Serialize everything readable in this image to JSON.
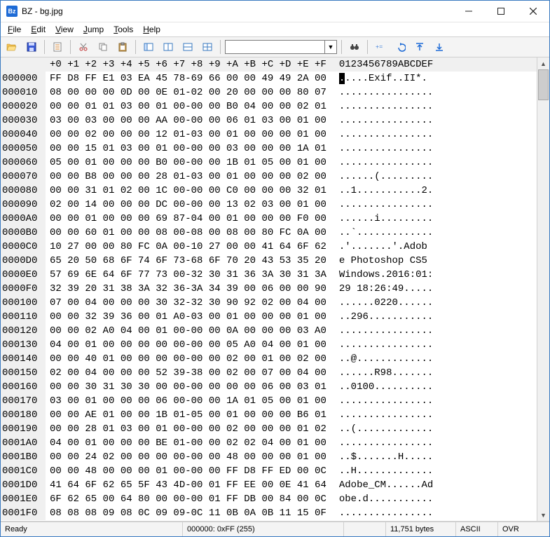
{
  "titlebar": {
    "icon_text": "Bz",
    "title": "BZ - bg.jpg"
  },
  "menu": {
    "file": "File",
    "edit": "Edit",
    "view": "View",
    "jump": "Jump",
    "tools": "Tools",
    "help": "Help"
  },
  "status": {
    "ready": "Ready",
    "offset": "000000: 0xFF (255)",
    "pad": "",
    "size": "11,751 bytes",
    "enc": "ASCII",
    "mode": "OVR"
  },
  "hex_header": {
    "addr_blank": "      ",
    "cols": [
      "+0",
      "+1",
      "+2",
      "+3",
      "+4",
      "+5",
      "+6",
      "+7",
      "+8",
      "+9",
      "+A",
      "+B",
      "+C",
      "+D",
      "+E",
      "+F"
    ],
    "ascii": "0123456789ABCDEF"
  },
  "rows": [
    {
      "addr": "000000",
      "b": [
        "FF",
        "D8",
        "FF",
        "E1",
        "03",
        "EA",
        "45",
        "78",
        "69",
        "66",
        "00",
        "00",
        "49",
        "49",
        "2A",
        "00"
      ],
      "a": ".....Exif..II*."
    },
    {
      "addr": "000010",
      "b": [
        "08",
        "00",
        "00",
        "00",
        "0D",
        "00",
        "0E",
        "01",
        "02",
        "00",
        "20",
        "00",
        "00",
        "00",
        "80",
        "07"
      ],
      "a": "................"
    },
    {
      "addr": "000020",
      "b": [
        "00",
        "00",
        "01",
        "01",
        "03",
        "00",
        "01",
        "00",
        "00",
        "00",
        "B0",
        "04",
        "00",
        "00",
        "02",
        "01"
      ],
      "a": "................"
    },
    {
      "addr": "000030",
      "b": [
        "03",
        "00",
        "03",
        "00",
        "00",
        "00",
        "AA",
        "00",
        "00",
        "00",
        "06",
        "01",
        "03",
        "00",
        "01",
        "00"
      ],
      "a": "................"
    },
    {
      "addr": "000040",
      "b": [
        "00",
        "00",
        "02",
        "00",
        "00",
        "00",
        "12",
        "01",
        "03",
        "00",
        "01",
        "00",
        "00",
        "00",
        "01",
        "00"
      ],
      "a": "................"
    },
    {
      "addr": "000050",
      "b": [
        "00",
        "00",
        "15",
        "01",
        "03",
        "00",
        "01",
        "00",
        "00",
        "00",
        "03",
        "00",
        "00",
        "00",
        "1A",
        "01"
      ],
      "a": "................"
    },
    {
      "addr": "000060",
      "b": [
        "05",
        "00",
        "01",
        "00",
        "00",
        "00",
        "B0",
        "00",
        "00",
        "00",
        "1B",
        "01",
        "05",
        "00",
        "01",
        "00"
      ],
      "a": "................"
    },
    {
      "addr": "000070",
      "b": [
        "00",
        "00",
        "B8",
        "00",
        "00",
        "00",
        "28",
        "01",
        "03",
        "00",
        "01",
        "00",
        "00",
        "00",
        "02",
        "00"
      ],
      "a": "......(........."
    },
    {
      "addr": "000080",
      "b": [
        "00",
        "00",
        "31",
        "01",
        "02",
        "00",
        "1C",
        "00",
        "00",
        "00",
        "C0",
        "00",
        "00",
        "00",
        "32",
        "01"
      ],
      "a": "..1...........2."
    },
    {
      "addr": "000090",
      "b": [
        "02",
        "00",
        "14",
        "00",
        "00",
        "00",
        "DC",
        "00",
        "00",
        "00",
        "13",
        "02",
        "03",
        "00",
        "01",
        "00"
      ],
      "a": "................"
    },
    {
      "addr": "0000A0",
      "b": [
        "00",
        "00",
        "01",
        "00",
        "00",
        "00",
        "69",
        "87",
        "04",
        "00",
        "01",
        "00",
        "00",
        "00",
        "F0",
        "00"
      ],
      "a": "......i........."
    },
    {
      "addr": "0000B0",
      "b": [
        "00",
        "00",
        "60",
        "01",
        "00",
        "00",
        "08",
        "00",
        "08",
        "00",
        "08",
        "00",
        "80",
        "FC",
        "0A",
        "00"
      ],
      "a": "..`............."
    },
    {
      "addr": "0000C0",
      "b": [
        "10",
        "27",
        "00",
        "00",
        "80",
        "FC",
        "0A",
        "00",
        "10",
        "27",
        "00",
        "00",
        "41",
        "64",
        "6F",
        "62"
      ],
      "a": ".'.......'.Adob"
    },
    {
      "addr": "0000D0",
      "b": [
        "65",
        "20",
        "50",
        "68",
        "6F",
        "74",
        "6F",
        "73",
        "68",
        "6F",
        "70",
        "20",
        "43",
        "53",
        "35",
        "20"
      ],
      "a": "e Photoshop CS5 "
    },
    {
      "addr": "0000E0",
      "b": [
        "57",
        "69",
        "6E",
        "64",
        "6F",
        "77",
        "73",
        "00",
        "32",
        "30",
        "31",
        "36",
        "3A",
        "30",
        "31",
        "3A"
      ],
      "a": "Windows.2016:01:"
    },
    {
      "addr": "0000F0",
      "b": [
        "32",
        "39",
        "20",
        "31",
        "38",
        "3A",
        "32",
        "36",
        "3A",
        "34",
        "39",
        "00",
        "06",
        "00",
        "00",
        "90"
      ],
      "a": "29 18:26:49....."
    },
    {
      "addr": "000100",
      "b": [
        "07",
        "00",
        "04",
        "00",
        "00",
        "00",
        "30",
        "32",
        "32",
        "30",
        "90",
        "92",
        "02",
        "00",
        "04",
        "00"
      ],
      "a": "......0220......"
    },
    {
      "addr": "000110",
      "b": [
        "00",
        "00",
        "32",
        "39",
        "36",
        "00",
        "01",
        "A0",
        "03",
        "00",
        "01",
        "00",
        "00",
        "00",
        "01",
        "00"
      ],
      "a": "..296..........."
    },
    {
      "addr": "000120",
      "b": [
        "00",
        "00",
        "02",
        "A0",
        "04",
        "00",
        "01",
        "00",
        "00",
        "00",
        "0A",
        "00",
        "00",
        "00",
        "03",
        "A0"
      ],
      "a": "................"
    },
    {
      "addr": "000130",
      "b": [
        "04",
        "00",
        "01",
        "00",
        "00",
        "00",
        "00",
        "00",
        "00",
        "00",
        "05",
        "A0",
        "04",
        "00",
        "01",
        "00"
      ],
      "a": "................"
    },
    {
      "addr": "000140",
      "b": [
        "00",
        "00",
        "40",
        "01",
        "00",
        "00",
        "00",
        "00",
        "00",
        "00",
        "02",
        "00",
        "01",
        "00",
        "02",
        "00"
      ],
      "a": "..@............."
    },
    {
      "addr": "000150",
      "b": [
        "02",
        "00",
        "04",
        "00",
        "00",
        "00",
        "52",
        "39",
        "38",
        "00",
        "02",
        "00",
        "07",
        "00",
        "04",
        "00"
      ],
      "a": "......R98......."
    },
    {
      "addr": "000160",
      "b": [
        "00",
        "00",
        "30",
        "31",
        "30",
        "30",
        "00",
        "00",
        "00",
        "00",
        "00",
        "00",
        "06",
        "00",
        "03",
        "01"
      ],
      "a": "..0100.........."
    },
    {
      "addr": "000170",
      "b": [
        "03",
        "00",
        "01",
        "00",
        "00",
        "00",
        "06",
        "00",
        "00",
        "00",
        "1A",
        "01",
        "05",
        "00",
        "01",
        "00"
      ],
      "a": "................"
    },
    {
      "addr": "000180",
      "b": [
        "00",
        "00",
        "AE",
        "01",
        "00",
        "00",
        "1B",
        "01",
        "05",
        "00",
        "01",
        "00",
        "00",
        "00",
        "B6",
        "01"
      ],
      "a": "................"
    },
    {
      "addr": "000190",
      "b": [
        "00",
        "00",
        "28",
        "01",
        "03",
        "00",
        "01",
        "00",
        "00",
        "00",
        "02",
        "00",
        "00",
        "00",
        "01",
        "02"
      ],
      "a": "..(............."
    },
    {
      "addr": "0001A0",
      "b": [
        "04",
        "00",
        "01",
        "00",
        "00",
        "00",
        "BE",
        "01",
        "00",
        "00",
        "02",
        "02",
        "04",
        "00",
        "01",
        "00"
      ],
      "a": "................"
    },
    {
      "addr": "0001B0",
      "b": [
        "00",
        "00",
        "24",
        "02",
        "00",
        "00",
        "00",
        "00",
        "00",
        "00",
        "48",
        "00",
        "00",
        "00",
        "01",
        "00"
      ],
      "a": "..$.......H....."
    },
    {
      "addr": "0001C0",
      "b": [
        "00",
        "00",
        "48",
        "00",
        "00",
        "00",
        "01",
        "00",
        "00",
        "00",
        "FF",
        "D8",
        "FF",
        "ED",
        "00",
        "0C"
      ],
      "a": "..H............."
    },
    {
      "addr": "0001D0",
      "b": [
        "41",
        "64",
        "6F",
        "62",
        "65",
        "5F",
        "43",
        "4D",
        "00",
        "01",
        "FF",
        "EE",
        "00",
        "0E",
        "41",
        "64"
      ],
      "a": "Adobe_CM......Ad"
    },
    {
      "addr": "0001E0",
      "b": [
        "6F",
        "62",
        "65",
        "00",
        "64",
        "80",
        "00",
        "00",
        "00",
        "01",
        "FF",
        "DB",
        "00",
        "84",
        "00",
        "0C"
      ],
      "a": "obe.d..........."
    },
    {
      "addr": "0001F0",
      "b": [
        "08",
        "08",
        "08",
        "09",
        "08",
        "0C",
        "09",
        "09",
        "0C",
        "11",
        "0B",
        "0A",
        "0B",
        "11",
        "15",
        "0F"
      ],
      "a": "................"
    }
  ]
}
